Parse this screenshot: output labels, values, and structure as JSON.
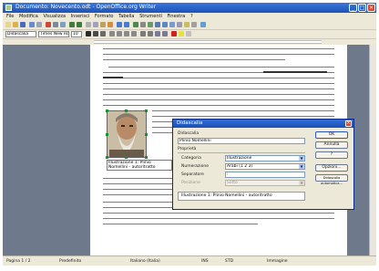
{
  "window": {
    "title": "Documento: Novecento.odt - OpenOffice.org Writer",
    "minimize_glyph": "_",
    "maximize_glyph": "□",
    "close_glyph": "×"
  },
  "menu": [
    "File",
    "Modifica",
    "Visualizza",
    "Inserisci",
    "Formato",
    "Tabella",
    "Strumenti",
    "Finestra",
    "?"
  ],
  "toolbar_format": {
    "style_value": "Didascalia",
    "font_value": "Times New Roman",
    "size_value": "10"
  },
  "caption_text": "Illustrazione 1: Plinio Nomellini - autoritratto",
  "dialog": {
    "title": "Didascalia",
    "caption_label": "Didascalia",
    "caption_value": "Plinio Nomellini",
    "properties_label": "Proprietà",
    "category_label": "Categoria",
    "category_value": "Illustrazione",
    "numbering_label": "Numerazione",
    "numbering_value": "Arabi (1 2 3)",
    "separator_label": "Separatore",
    "separator_value": ":",
    "position_label": "Posizione",
    "position_value": "Sotto",
    "preview_text": "Illustrazione 1: Plinio Nomellini - autoritratto",
    "buttons": [
      "OK",
      "Annulla",
      "?",
      "Opzioni...",
      "Didascalia automatica..."
    ]
  },
  "status": {
    "page": "Pagina 1 / 2",
    "style": "Predefinito",
    "language": "Italiano (Italia)",
    "mode": "INS",
    "std": "STD",
    "object": "Immagine"
  },
  "colors": {
    "titlebar": "#2b64cc",
    "workspace": "#6e7a8c",
    "dialog_face": "#ece9d8",
    "selection_handles": "#1e8e2e"
  }
}
